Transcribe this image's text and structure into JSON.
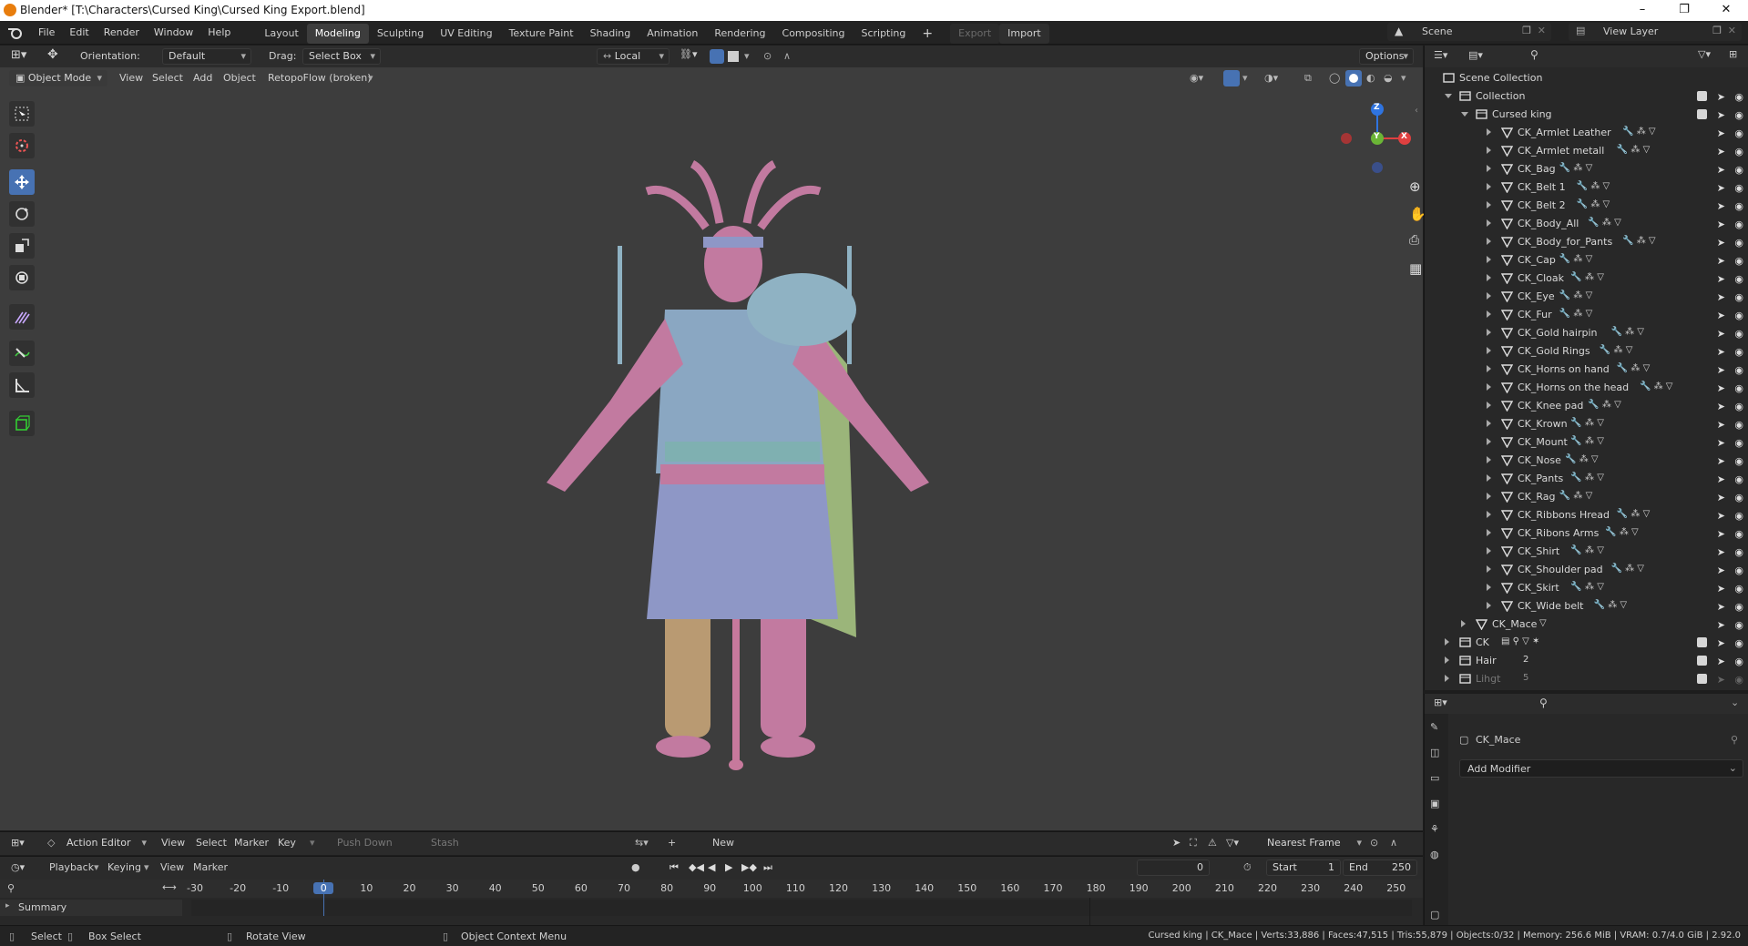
{
  "window": {
    "title": "Blender* [T:\\Characters\\Cursed King\\Cursed King Export.blend]",
    "controls": [
      "–",
      "❐",
      "✕"
    ]
  },
  "menu": [
    "File",
    "Edit",
    "Render",
    "Window",
    "Help"
  ],
  "workspaces": [
    "Layout",
    "Modeling",
    "Sculpting",
    "UV Editing",
    "Texture Paint",
    "Shading",
    "Animation",
    "Rendering",
    "Compositing",
    "Scripting"
  ],
  "active_workspace": "Modeling",
  "addon_buttons": {
    "export": "Export",
    "import": "Import"
  },
  "scene": {
    "scene_name": "Scene",
    "view_layer": "View Layer"
  },
  "vp_header": {
    "orientation_label": "Orientation:",
    "orientation_value": "Default",
    "drag_label": "Drag:",
    "drag_value": "Select Box",
    "pivot_value": "Local",
    "options": "Options"
  },
  "vp_header2": {
    "mode": "Object Mode",
    "menus": [
      "View",
      "Select",
      "Add",
      "Object"
    ],
    "addon": "RetopoFlow (broken)"
  },
  "gizmo": {
    "z": "Z",
    "y": "Y",
    "x": "X"
  },
  "outliner": {
    "scene_collection": "Scene Collection",
    "collection": "Collection",
    "cursed_king": "Cursed king",
    "objects": [
      "CK_Armlet Leather",
      "CK_Armlet metall",
      "CK_Bag",
      "CK_Belt 1",
      "CK_Belt 2",
      "CK_Body_All",
      "CK_Body_for_Pants",
      "CK_Cap",
      "CK_Cloak",
      "CK_Eye",
      "CK_Fur",
      "CK_Gold hairpin",
      "CK_Gold Rings",
      "CK_Horns on hand",
      "CK_Horns on the head",
      "CK_Knee pad",
      "CK_Krown",
      "CK_Mount",
      "CK_Nose",
      "CK_Pants",
      "CK_Rag",
      "CK_Ribbons Hread",
      "CK_Ribons Arms",
      "CK_Shirt",
      "CK_Shoulder pad",
      "CK_Skirt",
      "CK_Wide belt"
    ],
    "mace": "CK_Mace",
    "ck": "CK",
    "hair": "Hair",
    "light": "Lihgt",
    "hair_count": "2",
    "light_count": "5"
  },
  "properties": {
    "object_name": "CK_Mace",
    "add_modifier": "Add Modifier"
  },
  "action_editor": {
    "editor": "Action Editor",
    "menus": [
      "View",
      "Select",
      "Marker",
      "Key"
    ],
    "push_down": "Push Down",
    "stash": "Stash",
    "new": "New",
    "snap": "Nearest Frame"
  },
  "timeline": {
    "menus": [
      "Playback",
      "Keying",
      "View",
      "Marker"
    ],
    "current_frame": "0",
    "start_label": "Start",
    "start": "1",
    "end_label": "End",
    "end": "250",
    "ticks": [
      "-30",
      "-20",
      "-10",
      "0",
      "10",
      "20",
      "30",
      "40",
      "50",
      "60",
      "70",
      "80",
      "90",
      "100",
      "110",
      "120",
      "130",
      "140",
      "150",
      "160",
      "170",
      "180",
      "190",
      "200",
      "210",
      "220",
      "230",
      "240",
      "250"
    ],
    "summary": "Summary"
  },
  "status": {
    "select": "Select",
    "box_select": "Box Select",
    "rotate": "Rotate View",
    "context": "Object Context Menu",
    "stats": "Cursed king | CK_Mace | Verts:33,886 | Faces:47,515 | Tris:55,879 | Objects:0/32 | Memory: 256.6 MiB | VRAM: 0.7/4.0 GiB | 2.92.0"
  },
  "colors": {
    "accent": "#4772b3",
    "viewport_bg": "#3d3d3d",
    "panel_bg": "#282828"
  }
}
